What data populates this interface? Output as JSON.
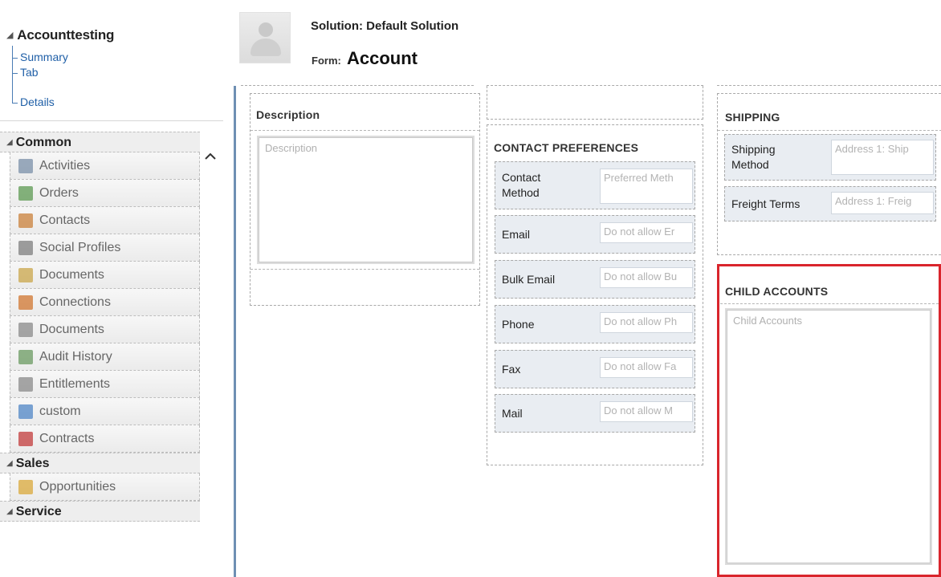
{
  "tree": {
    "root": "Accounttesting",
    "children": [
      "Summary",
      "Tab",
      "Details"
    ]
  },
  "nav": {
    "common": {
      "label": "Common",
      "items": [
        {
          "label": "Activities",
          "icon": "activities-icon",
          "color": "#7a8fa8"
        },
        {
          "label": "Orders",
          "icon": "orders-icon",
          "color": "#5c9a52"
        },
        {
          "label": "Contacts",
          "icon": "contacts-icon",
          "color": "#c9803a"
        },
        {
          "label": "Social Profiles",
          "icon": "social-profiles-icon",
          "color": "#7d7d7d"
        },
        {
          "label": "Documents",
          "icon": "documents-icon",
          "color": "#c9a54a"
        },
        {
          "label": "Connections",
          "icon": "connections-icon",
          "color": "#d0762f"
        },
        {
          "label": "Documents",
          "icon": "documents-icon",
          "color": "#8a8a8a"
        },
        {
          "label": "Audit History",
          "icon": "audit-history-icon",
          "color": "#6a9a60"
        },
        {
          "label": "Entitlements",
          "icon": "entitlements-icon",
          "color": "#8a8a8a"
        },
        {
          "label": "custom",
          "icon": "custom-icon",
          "color": "#4f86c6"
        },
        {
          "label": "Contracts",
          "icon": "contracts-icon",
          "color": "#c23b3b"
        }
      ]
    },
    "sales": {
      "label": "Sales",
      "items": [
        {
          "label": "Opportunities",
          "icon": "opportunities-icon",
          "color": "#d9a83a"
        }
      ]
    },
    "service": {
      "label": "Service"
    }
  },
  "header": {
    "solution": "Solution: Default Solution",
    "form_label": "Form:",
    "form_value": "Account"
  },
  "description": {
    "title": "Description",
    "placeholder": "Description"
  },
  "contact_preferences": {
    "title": "CONTACT PREFERENCES",
    "fields": [
      {
        "label": "Contact Method",
        "value": "Preferred Meth"
      },
      {
        "label": "Email",
        "value": "Do not allow Er"
      },
      {
        "label": "Bulk Email",
        "value": "Do not allow Bu"
      },
      {
        "label": "Phone",
        "value": "Do not allow Ph"
      },
      {
        "label": "Fax",
        "value": "Do not allow Fa"
      },
      {
        "label": "Mail",
        "value": "Do not allow M"
      }
    ]
  },
  "shipping": {
    "title": "SHIPPING",
    "fields": [
      {
        "label": "Shipping Method",
        "value": "Address 1: Ship"
      },
      {
        "label": "Freight Terms",
        "value": "Address 1: Freig"
      }
    ]
  },
  "child_accounts": {
    "title": "CHILD ACCOUNTS",
    "placeholder": "Child Accounts"
  },
  "colors": {
    "highlight": "#d9252c",
    "link": "#1f5fa7",
    "canvas_bar": "#6e8fb3"
  }
}
